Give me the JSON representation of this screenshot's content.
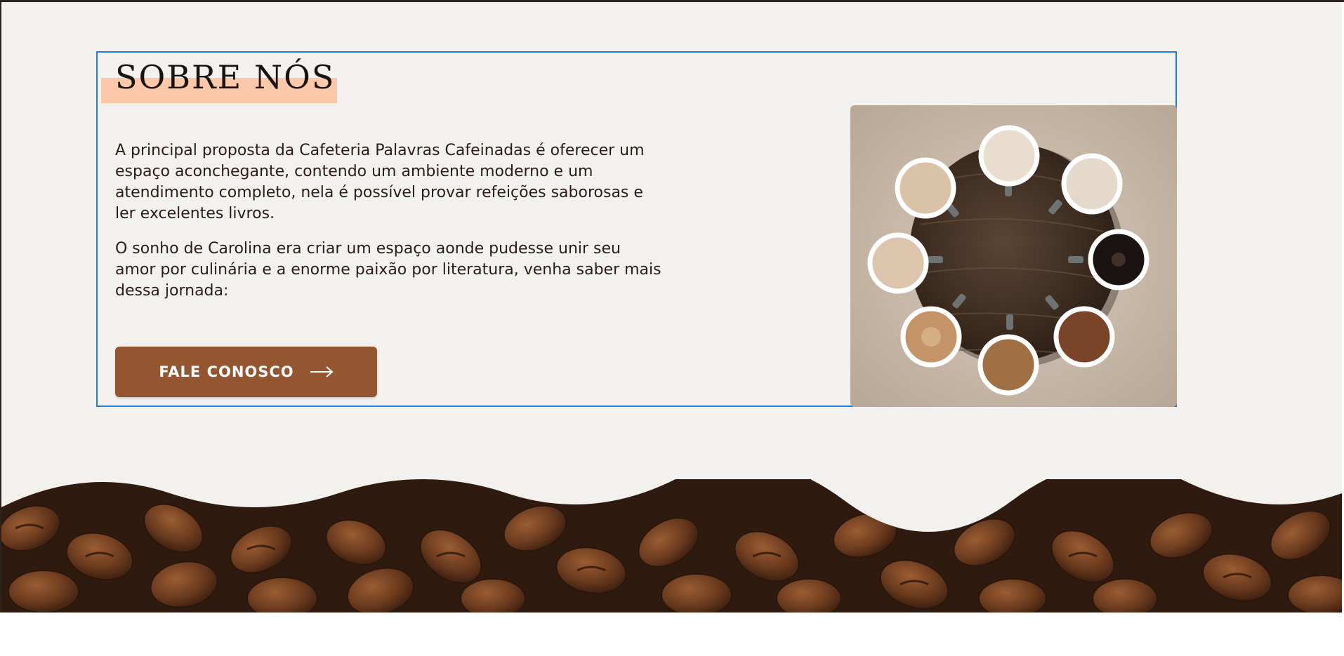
{
  "about": {
    "title": "SOBRE NÓS",
    "paragraph_1": "A principal proposta da Cafeteria Palavras Cafeinadas é oferecer um espaço aconchegante, contendo um ambiente moderno e um atendimento completo, nela é possível provar refeições saborosas e ler excelentes livros.",
    "paragraph_2": "O sonho de Carolina era criar um espaço aonde pudesse unir seu amor por culinária e a enorme paixão por literatura, venha saber mais dessa jornada:",
    "cta_label": "FALE CONOSCO",
    "cta_icon": "arrow-right-icon"
  },
  "images": {
    "photo": "coffee-cups-on-round-wooden-tray",
    "footer_band": "coffee-beans-wavy-band"
  },
  "colors": {
    "section_background": "#f3f1ed",
    "title_highlight": "#fbc9a9",
    "cta_background": "#935631",
    "selection_outline": "#1f7fe0"
  }
}
